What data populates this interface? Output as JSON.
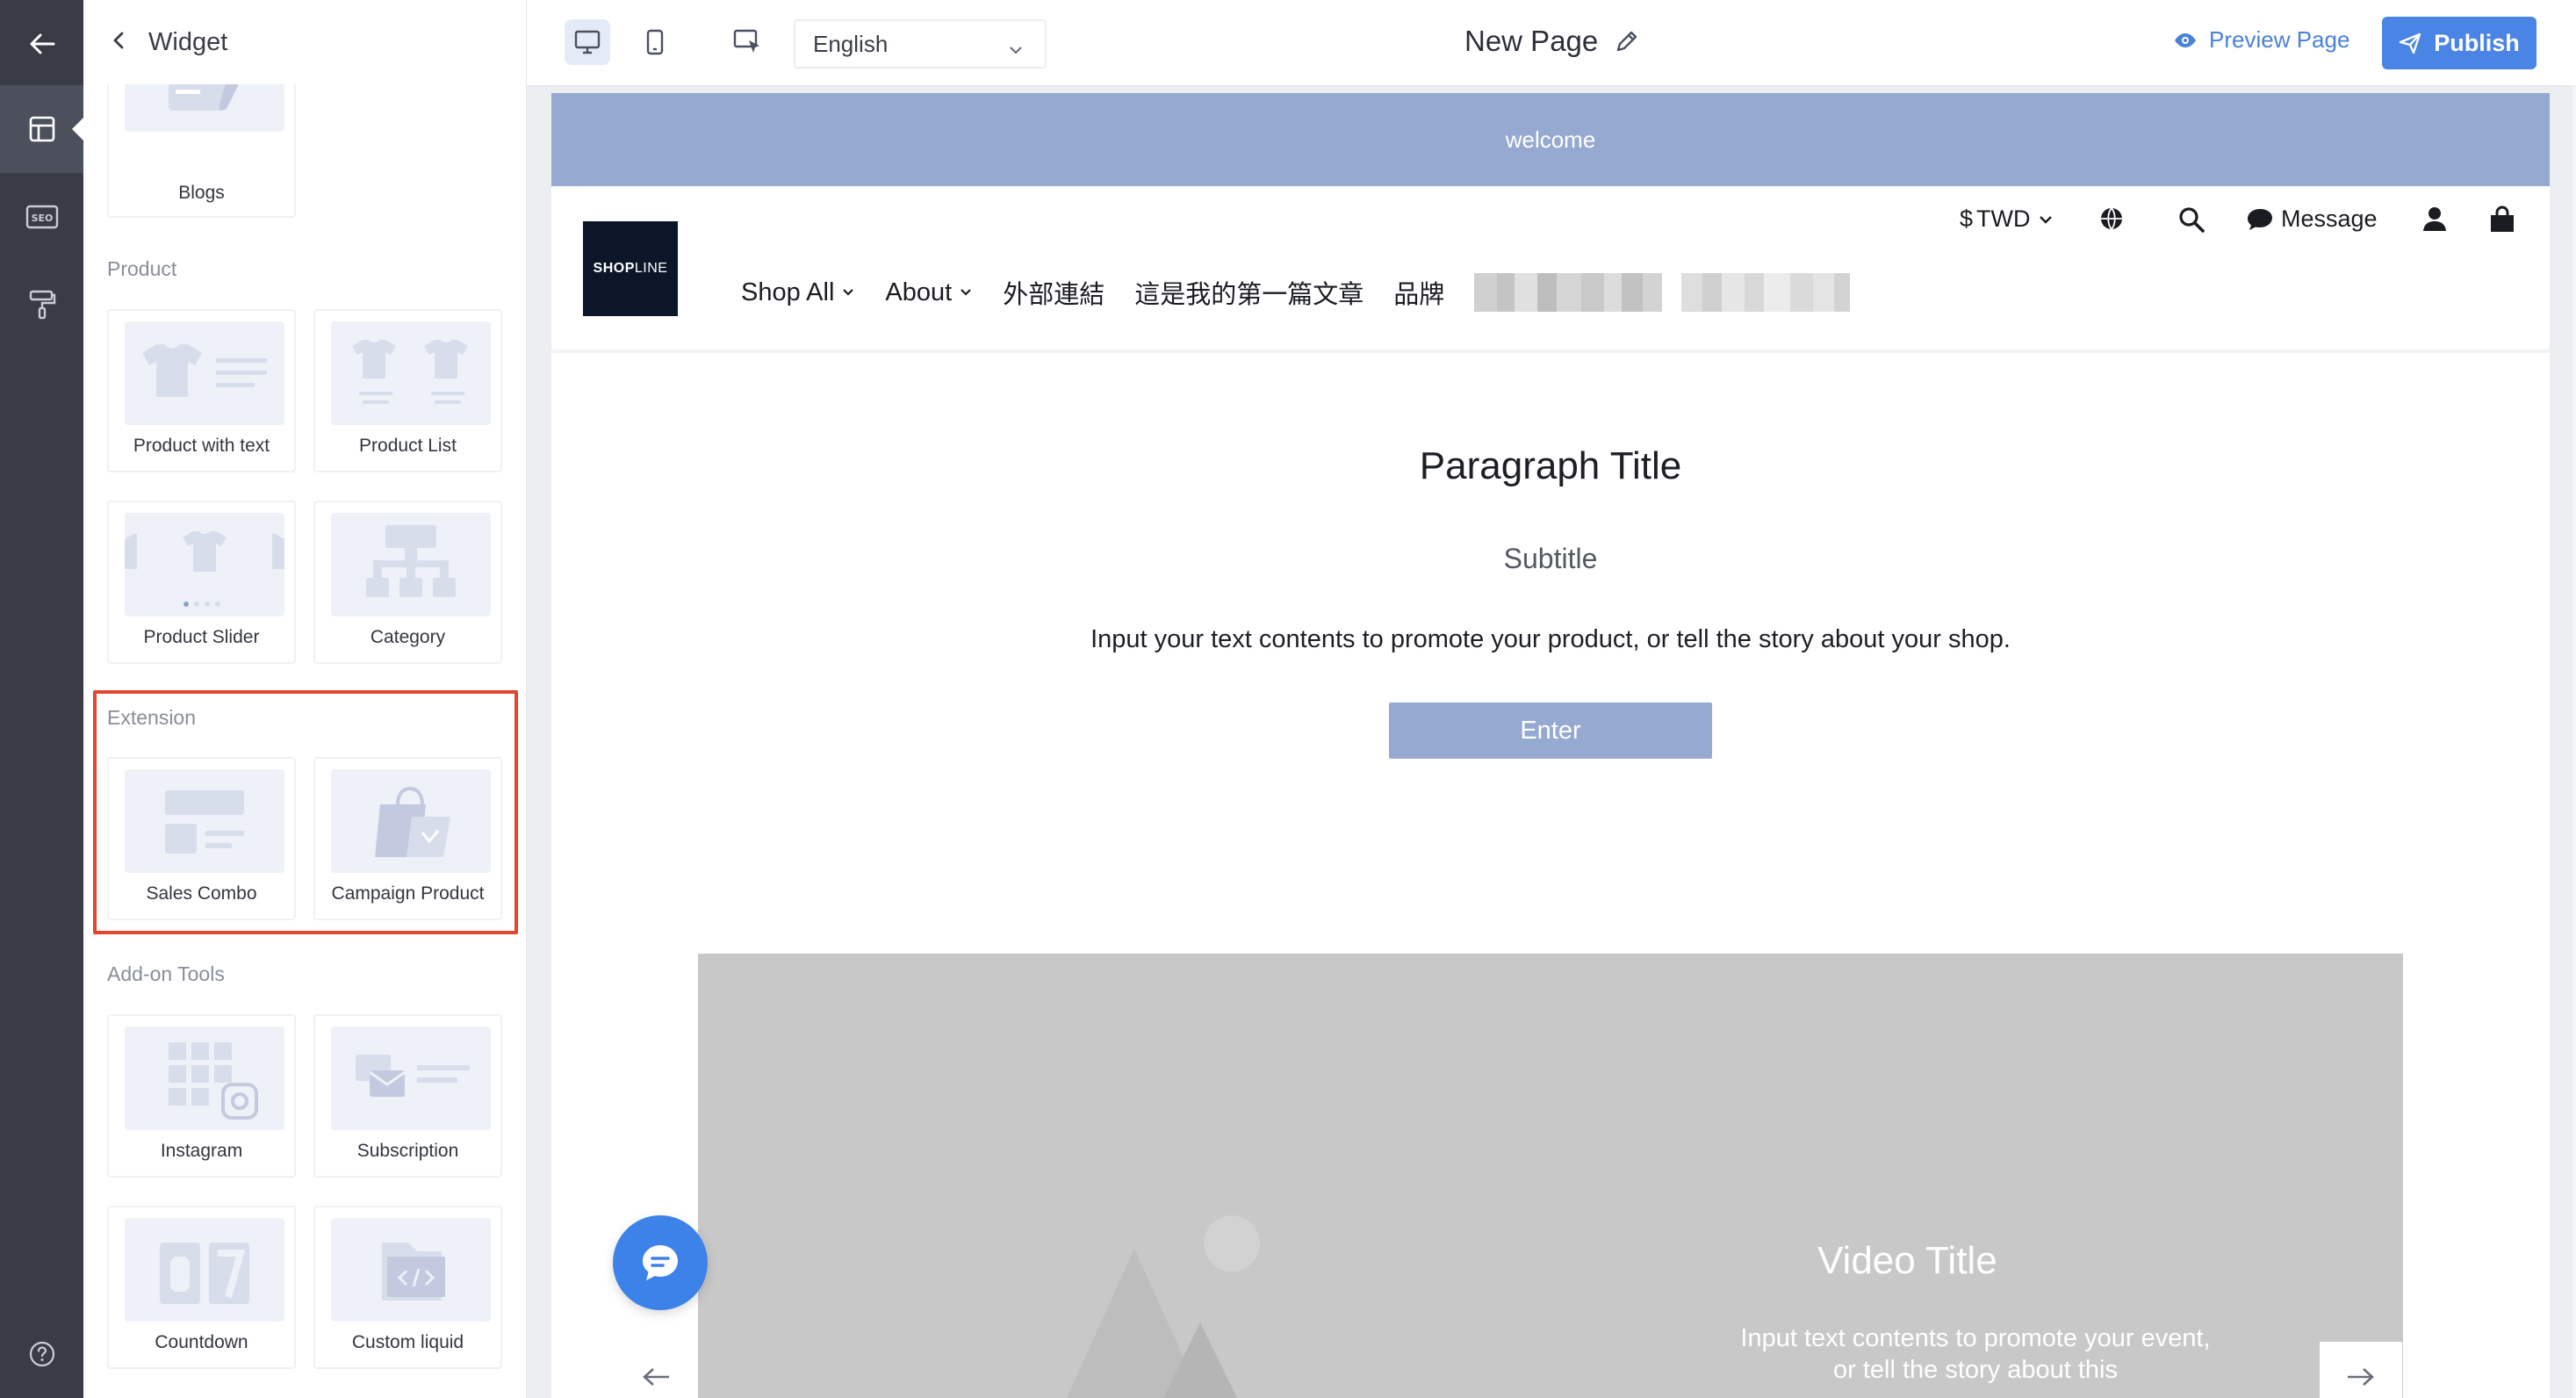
{
  "panel": {
    "title": "Widget",
    "blogs_card": {
      "label": "Blogs"
    },
    "sections": [
      {
        "label": "Product",
        "items": [
          "Product with text",
          "Product List",
          "Product Slider",
          "Category"
        ]
      },
      {
        "label": "Extension",
        "items": [
          "Sales Combo",
          "Campaign Product"
        ]
      },
      {
        "label": "Add-on Tools",
        "items": [
          "Instagram",
          "Subscription",
          "Countdown",
          "Custom liquid"
        ]
      }
    ],
    "highlight_color": "#e1472f"
  },
  "rail": {
    "items": [
      "back-arrow-icon",
      "layout-icon",
      "seo-icon",
      "paint-roller-icon"
    ],
    "bottom": "help-icon"
  },
  "toolbar": {
    "language": "English",
    "page_title": "New Page",
    "preview_label": "Preview Page",
    "publish_label": "Publish",
    "accent": "#4a84e4"
  },
  "site": {
    "announcement": "welcome",
    "logo_text_bold": "SHOP",
    "logo_text_thin": "LINE",
    "currency": "TWD",
    "currency_symbol": "$",
    "message_label": "Message",
    "nav": [
      "Shop All",
      "About",
      "外部連結",
      "這是我的第一篇文章",
      "品牌"
    ],
    "paragraph": {
      "title": "Paragraph Title",
      "subtitle": "Subtitle",
      "body": "Input your text contents to promote your product, or tell the story about your shop.",
      "button": "Enter"
    },
    "video": {
      "title": "Video Title",
      "desc": "Input text contents to promote your event, or tell the story about this"
    },
    "brand_color": "#96a9d1"
  }
}
